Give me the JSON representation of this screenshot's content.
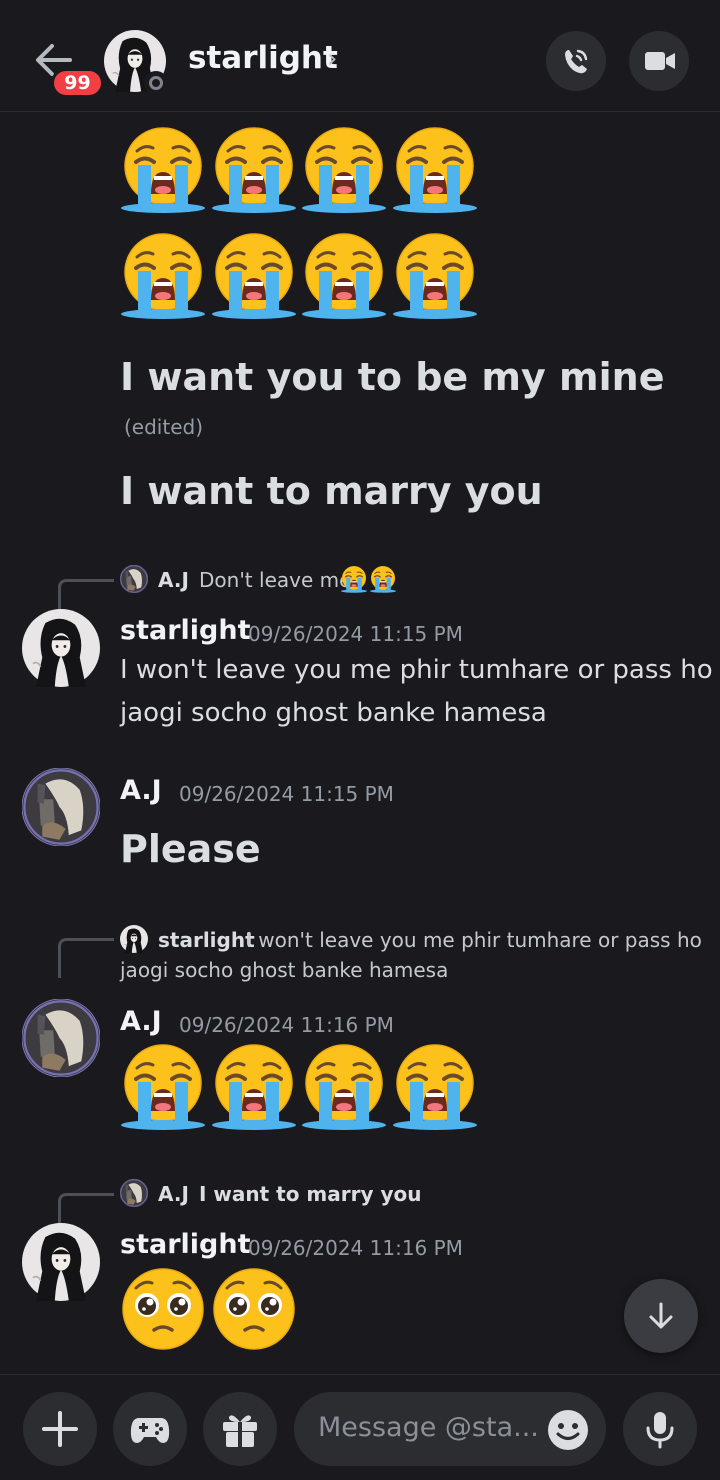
{
  "header": {
    "unread_badge": "99",
    "name": "starlight",
    "chevron": "›",
    "call_icon": "phone-call-icon",
    "video_icon": "video-camera-icon"
  },
  "messages": {
    "top_emoji": "loudly-crying-face",
    "top_emoji_rows": [
      4,
      4
    ],
    "text_1": "I want you to be my mine",
    "text_1_edited": "(edited)",
    "text_2": "I want to marry you",
    "m1": {
      "reply_author": "A.J",
      "reply_text": "Don't leave me",
      "reply_emoji_count": 2,
      "author": "starlight",
      "timestamp": "09/26/2024 11:15 PM",
      "line_1": "I won't leave you me phir tumhare or pass ho",
      "line_2": "jaogi socho ghost banke hamesa"
    },
    "m2": {
      "author": "A.J",
      "timestamp": "09/26/2024 11:15 PM",
      "text": "Please"
    },
    "m3": {
      "reply_author": "starlight",
      "reply_line_1": "I won't leave you me phir tumhare or pass ho",
      "reply_line_2": "jaogi socho ghost banke hamesa",
      "author": "A.J",
      "timestamp": "09/26/2024 11:16 PM",
      "emoji": "loudly-crying-face",
      "emoji_count": 4
    },
    "m4": {
      "reply_author": "A.J",
      "reply_text": "I want to marry you",
      "author": "starlight",
      "timestamp": "09/26/2024 11:16 PM",
      "emoji": "pleading-face",
      "emoji_count": 2
    }
  },
  "composer": {
    "placeholder": "Message @sta...",
    "add_icon": "plus-icon",
    "activities_icon": "gamepad-icon",
    "gift_icon": "gift-icon",
    "emoji_icon": "emoji-smile-icon",
    "mic_icon": "microphone-icon"
  },
  "colors": {
    "background": "#1a1a1e",
    "badge": "#f23f43",
    "text": "#dbdee1",
    "muted": "#949ba4"
  }
}
